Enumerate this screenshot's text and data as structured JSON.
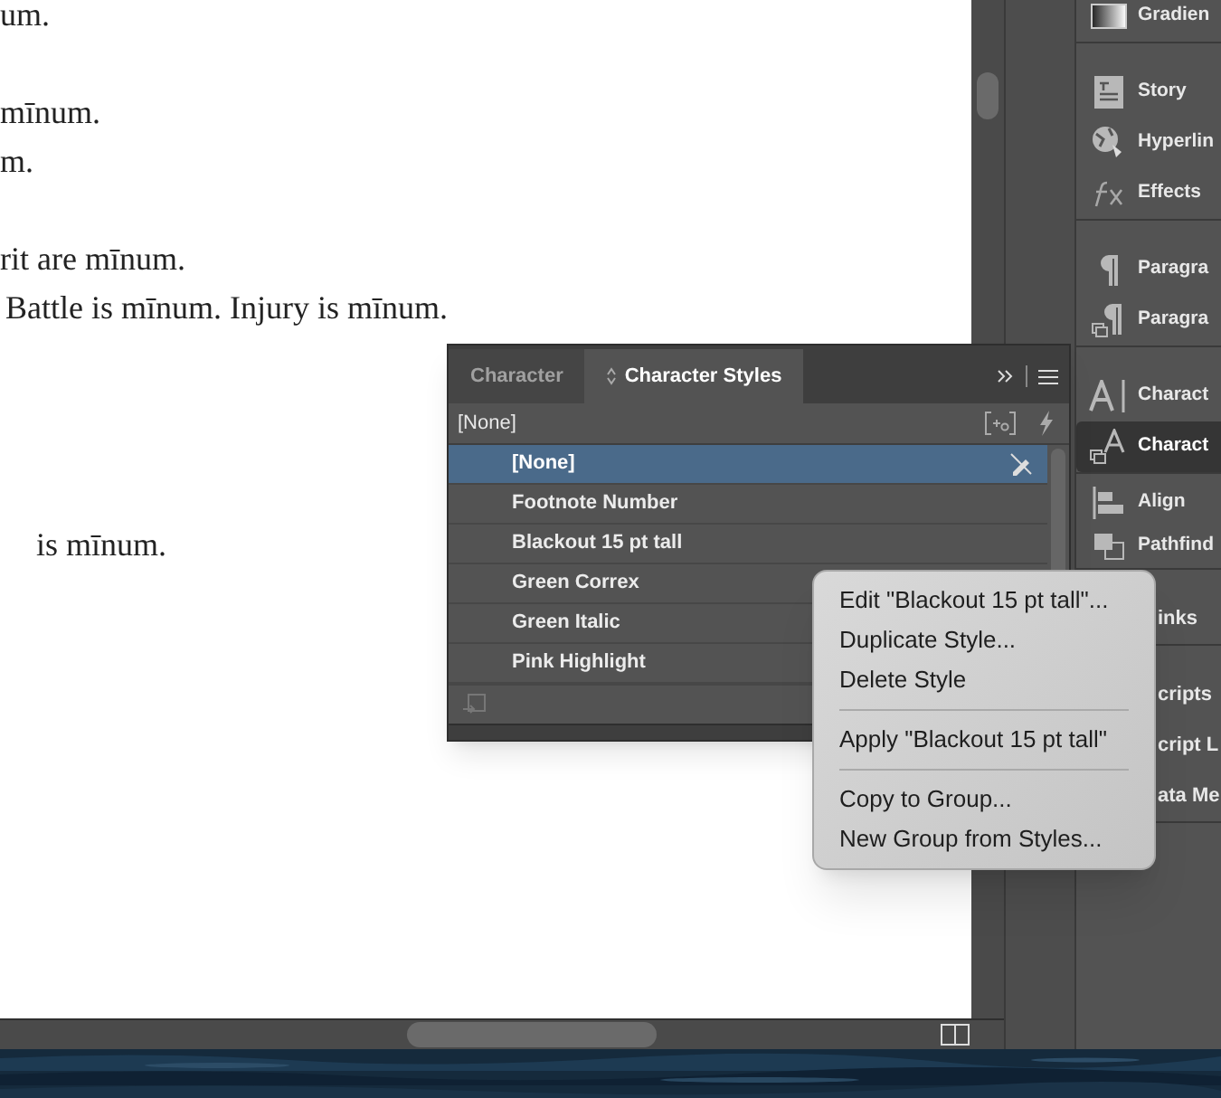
{
  "document": {
    "lines": [
      "um.",
      "mīnum.",
      "m.",
      "rit are mīnum.",
      "Battle is mīnum. Injury is mīnum.",
      "is mīnum."
    ]
  },
  "panels": {
    "groups": [
      {
        "items": [
          {
            "label": "Gradien",
            "kind": "full",
            "selected": false
          }
        ]
      },
      {
        "items": [
          {
            "label": "Story",
            "kind": "full",
            "selected": false
          },
          {
            "label": "Hyperlin",
            "kind": "full",
            "selected": false
          },
          {
            "label": "Effects",
            "kind": "full",
            "selected": false
          }
        ]
      },
      {
        "items": [
          {
            "label": "Paragra",
            "kind": "full",
            "selected": false
          },
          {
            "label": "Paragra",
            "kind": "full",
            "selected": false
          }
        ]
      },
      {
        "items": [
          {
            "label": "Charact",
            "kind": "full",
            "selected": false
          },
          {
            "label": "Charact",
            "kind": "full",
            "selected": true
          }
        ]
      },
      {
        "items": [
          {
            "label": "Align",
            "kind": "full",
            "selected": false
          },
          {
            "label": "Pathfind",
            "kind": "full",
            "selected": false
          }
        ]
      },
      {
        "items": [
          {
            "label": "inks",
            "kind": "partial",
            "selected": false
          }
        ]
      },
      {
        "items": [
          {
            "label": "cripts",
            "kind": "partial",
            "selected": false
          },
          {
            "label": "cript L",
            "kind": "partial",
            "selected": false
          },
          {
            "label": "ata Me",
            "kind": "partial",
            "selected": false
          }
        ]
      }
    ]
  },
  "character_styles_panel": {
    "tabs": [
      {
        "label": "Character",
        "selected": false
      },
      {
        "label": "Character Styles",
        "selected": true
      }
    ],
    "current_style": "[None]",
    "styles": [
      {
        "name": "[None]",
        "selected": true
      },
      {
        "name": "Footnote Number",
        "selected": false
      },
      {
        "name": "Blackout 15 pt tall",
        "selected": false
      },
      {
        "name": "Green Correx",
        "selected": false
      },
      {
        "name": "Green Italic",
        "selected": false
      },
      {
        "name": "Pink Highlight",
        "selected": false
      }
    ]
  },
  "context_menu": {
    "items": [
      {
        "kind": "item",
        "label": "Edit \"Blackout 15 pt tall\"..."
      },
      {
        "kind": "item",
        "label": "Duplicate Style..."
      },
      {
        "kind": "item",
        "label": "Delete Style"
      },
      {
        "kind": "separator"
      },
      {
        "kind": "item",
        "label": "Apply \"Blackout 15 pt tall\""
      },
      {
        "kind": "separator"
      },
      {
        "kind": "item",
        "label": "Copy to Group..."
      },
      {
        "kind": "item",
        "label": "New Group from Styles..."
      }
    ]
  }
}
